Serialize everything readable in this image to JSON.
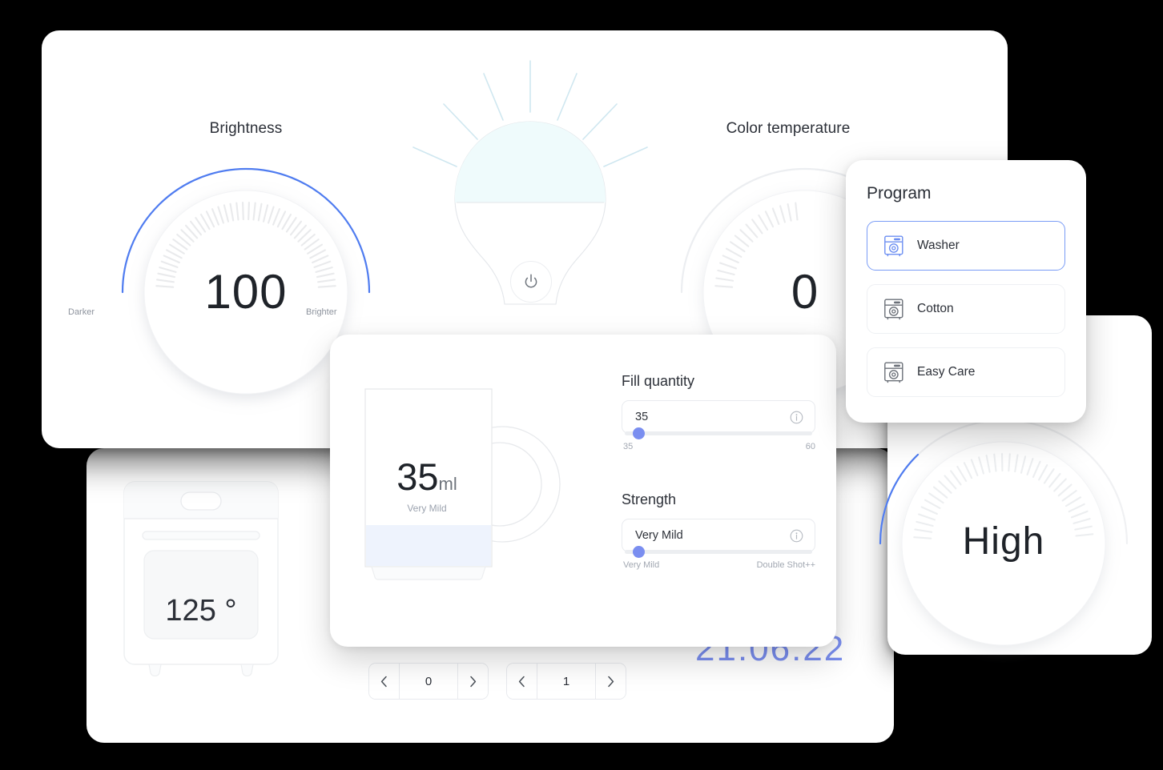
{
  "lighting": {
    "brightness": {
      "title": "Brightness",
      "value": "100",
      "min_label": "Darker",
      "max_label": "Brighter"
    },
    "color_temperature": {
      "title": "Color temperature",
      "value": "0"
    },
    "bulb": {
      "power_icon": "power-icon"
    }
  },
  "program": {
    "title": "Program",
    "items": [
      {
        "label": "Washer",
        "icon": "washing-machine-icon",
        "selected": true
      },
      {
        "label": "Cotton",
        "icon": "washing-machine-icon",
        "selected": false
      },
      {
        "label": "Easy Care",
        "icon": "washing-machine-icon",
        "selected": false
      }
    ]
  },
  "coffee": {
    "mug": {
      "amount": "35",
      "unit": "ml",
      "strength": "Very Mild"
    },
    "fill_quantity": {
      "title": "Fill quantity",
      "value": "35",
      "min": "35",
      "max": "60",
      "info_icon": "info-icon"
    },
    "strength": {
      "title": "Strength",
      "value": "Very Mild",
      "min": "Very Mild",
      "max": "Double Shot++",
      "info_icon": "info-icon"
    }
  },
  "appliance": {
    "oven": {
      "temperature": "125 °"
    },
    "steppers": [
      {
        "value": "0",
        "prev_icon": "chevron-left-icon",
        "next_icon": "chevron-right-icon"
      },
      {
        "value": "1",
        "prev_icon": "chevron-left-icon",
        "next_icon": "chevron-right-icon"
      }
    ],
    "clock": "21:06:22"
  },
  "right_dial": {
    "value": "High"
  },
  "colors": {
    "accent_blue": "#4f7cf0",
    "slider_blue": "#7a8ef0",
    "bulb_glow": "#effbfc",
    "ray": "#cfe7f0",
    "text_dark": "#2c3038",
    "muted": "#9ca3af"
  }
}
